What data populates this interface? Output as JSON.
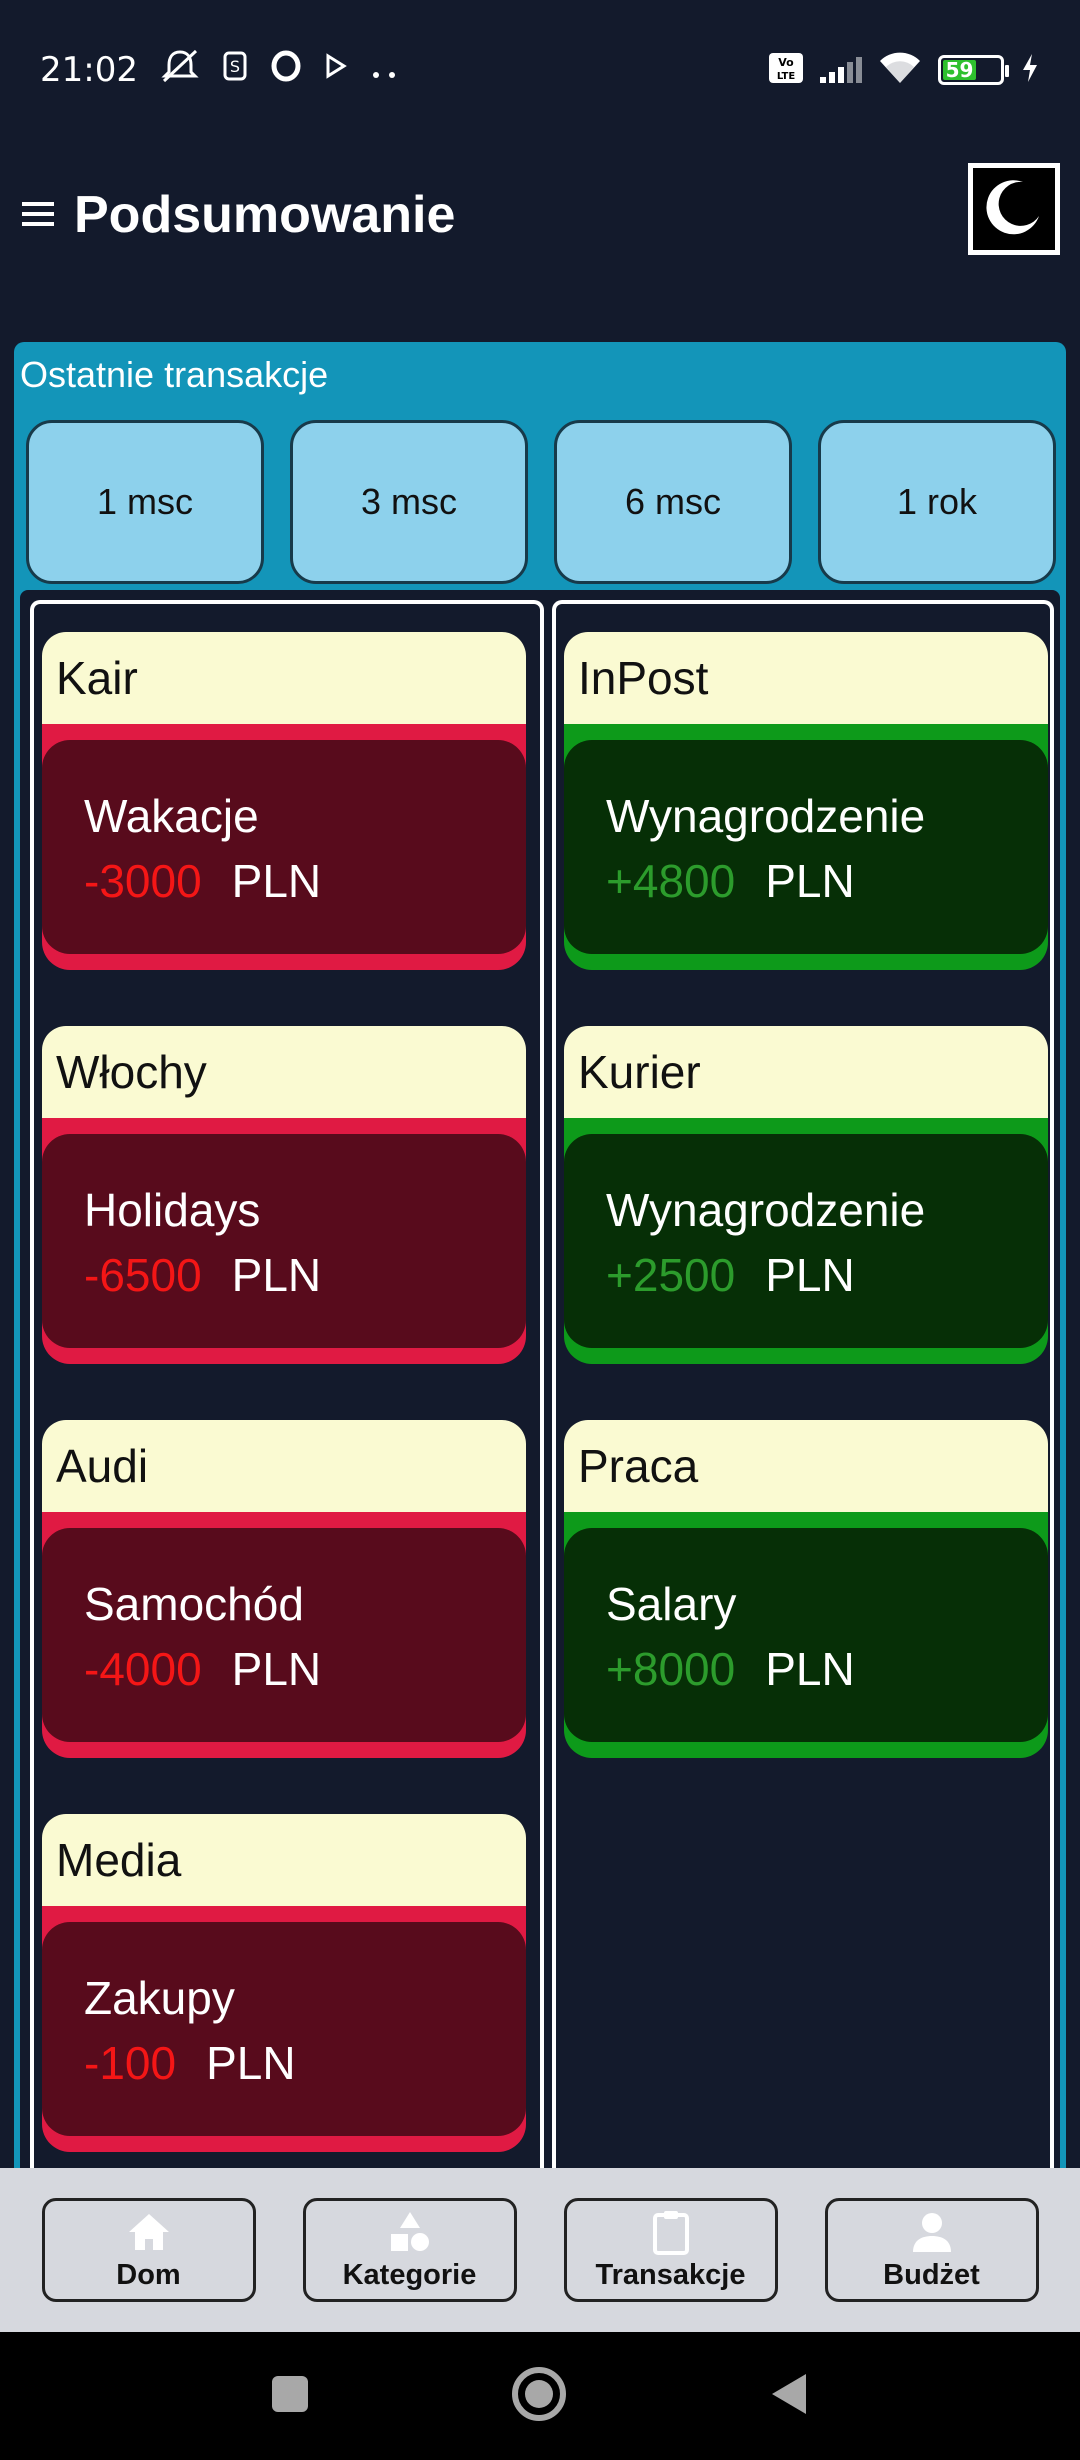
{
  "status_bar": {
    "time": "21:02",
    "battery": "59",
    "left_icons": [
      "muted-bell-icon",
      "s-icon",
      "opera-icon",
      "play-icon",
      "more-dots-icon"
    ],
    "right_icons": [
      "volte-icon",
      "signal-icon",
      "wifi-icon",
      "battery-icon",
      "charging-icon"
    ]
  },
  "app_bar": {
    "title": "Podsumowanie",
    "menu_icon": "hamburger-icon",
    "theme_icon": "moon-icon"
  },
  "panel": {
    "title": "Ostatnie transakcje",
    "ranges": [
      "1 msc",
      "3 msc",
      "6 msc",
      "1 rok"
    ]
  },
  "expenses": [
    {
      "name": "Kair",
      "category": "Wakacje",
      "amount": "-3000",
      "currency": "PLN"
    },
    {
      "name": "Włochy",
      "category": "Holidays",
      "amount": "-6500",
      "currency": "PLN"
    },
    {
      "name": "Audi",
      "category": "Samochód",
      "amount": "-4000",
      "currency": "PLN"
    },
    {
      "name": "Media",
      "category": "Zakupy",
      "amount": "-100",
      "currency": "PLN"
    }
  ],
  "incomes": [
    {
      "name": "InPost",
      "category": "Wynagrodzenie",
      "amount": "+4800",
      "currency": "PLN"
    },
    {
      "name": "Kurier",
      "category": "Wynagrodzenie",
      "amount": "+2500",
      "currency": "PLN"
    },
    {
      "name": "Praca",
      "category": "Salary",
      "amount": "+8000",
      "currency": "PLN"
    }
  ],
  "bottom_nav": [
    {
      "label": "Dom",
      "icon": "home-icon"
    },
    {
      "label": "Kategorie",
      "icon": "shapes-icon"
    },
    {
      "label": "Transakcje",
      "icon": "clipboard-icon"
    },
    {
      "label": "Budżet",
      "icon": "person-icon"
    }
  ],
  "colors": {
    "background": "#131a2c",
    "panel": "#1395b9",
    "range_button": "#8dd1ec",
    "card_header": "#fafad2",
    "expense_body": "#580b1c",
    "expense_accent": "#e01a43",
    "expense_amount": "#f41616",
    "income_body": "#062f06",
    "income_accent": "#0d9a1a",
    "income_amount": "#2c9c2c",
    "bottom_nav": "#d6d8de"
  }
}
